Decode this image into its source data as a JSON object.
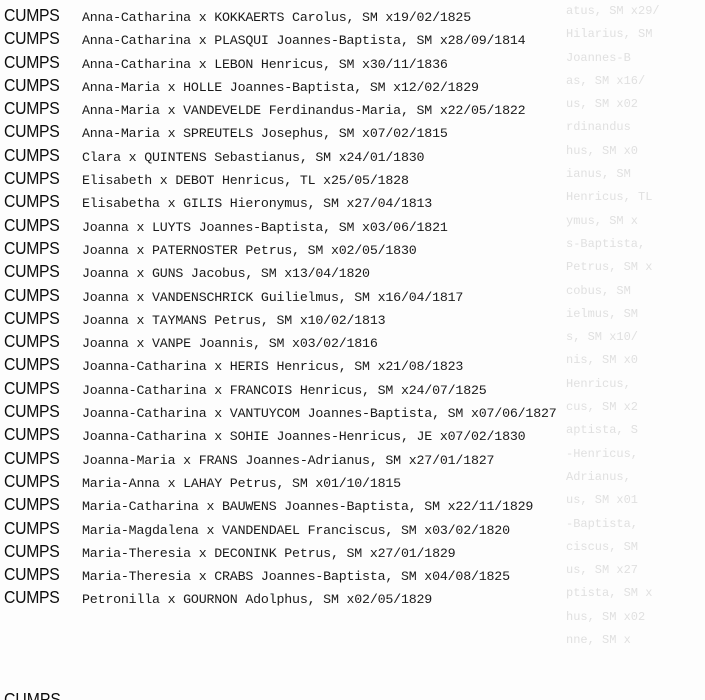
{
  "surname": "CUMPS",
  "entries": [
    "Anna-Catharina x KOKKAERTS Carolus, SM x19/02/1825",
    "Anna-Catharina x PLASQUI Joannes-Baptista, SM x28/09/1814",
    "Anna-Catharina x LEBON Henricus, SM x30/11/1836",
    "Anna-Maria x HOLLE Joannes-Baptista, SM x12/02/1829",
    "Anna-Maria x VANDEVELDE Ferdinandus-Maria, SM x22/05/1822",
    "Anna-Maria x SPREUTELS Josephus, SM x07/02/1815",
    "Clara x QUINTENS Sebastianus, SM x24/01/1830",
    "Elisabeth x DEBOT Henricus, TL x25/05/1828",
    "Elisabetha x GILIS Hieronymus, SM x27/04/1813",
    "Joanna x LUYTS Joannes-Baptista, SM x03/06/1821",
    "Joanna x PATERNOSTER Petrus, SM x02/05/1830",
    "Joanna x GUNS Jacobus, SM x13/04/1820",
    "Joanna x VANDENSCHRICK Guilielmus, SM x16/04/1817",
    "Joanna x TAYMANS Petrus, SM x10/02/1813",
    "Joanna x VANPE Joannis, SM x03/02/1816",
    "Joanna-Catharina x HERIS Henricus, SM x21/08/1823",
    "Joanna-Catharina x FRANCOIS Henricus, SM x24/07/1825",
    "Joanna-Catharina x VANTUYCOM Joannes-Baptista, SM x07/06/1827",
    "Joanna-Catharina x SOHIE Joannes-Henricus, JE x07/02/1830",
    "Joanna-Maria x FRANS Joannes-Adrianus, SM x27/01/1827",
    "Maria-Anna x LAHAY Petrus, SM x01/10/1815",
    "Maria-Catharina x BAUWENS Joannes-Baptista, SM x22/11/1829",
    "Maria-Magdalena x VANDENDAEL Franciscus, SM x03/02/1820",
    "Maria-Theresia x DECONINK Petrus, SM x27/01/1829",
    "Maria-Theresia x CRABS Joannes-Baptista, SM x04/08/1825",
    "Petronilla x GOURNON Adolphus, SM x02/05/1829"
  ],
  "cutoff_surname": "CUMPS",
  "bleed_through": [
    "atus, SM x29/",
    "Hilarius, SM",
    "Joannes-B",
    "as, SM x16/",
    "us, SM x02",
    "rdinandus",
    "hus, SM x0",
    "ianus, SM",
    "Henricus, TL",
    "ymus, SM x",
    "s-Baptista,",
    "Petrus, SM x",
    "cobus, SM",
    "ielmus, SM",
    "s, SM x10/",
    "nis, SM x0",
    "Henricus,",
    "cus, SM x2",
    "aptista, S",
    "-Henricus,",
    "Adrianus,",
    "us, SM x01",
    "-Baptista,",
    "ciscus, SM",
    "us, SM x27",
    "ptista, SM x",
    "hus, SM x02",
    "nne, SM x"
  ]
}
